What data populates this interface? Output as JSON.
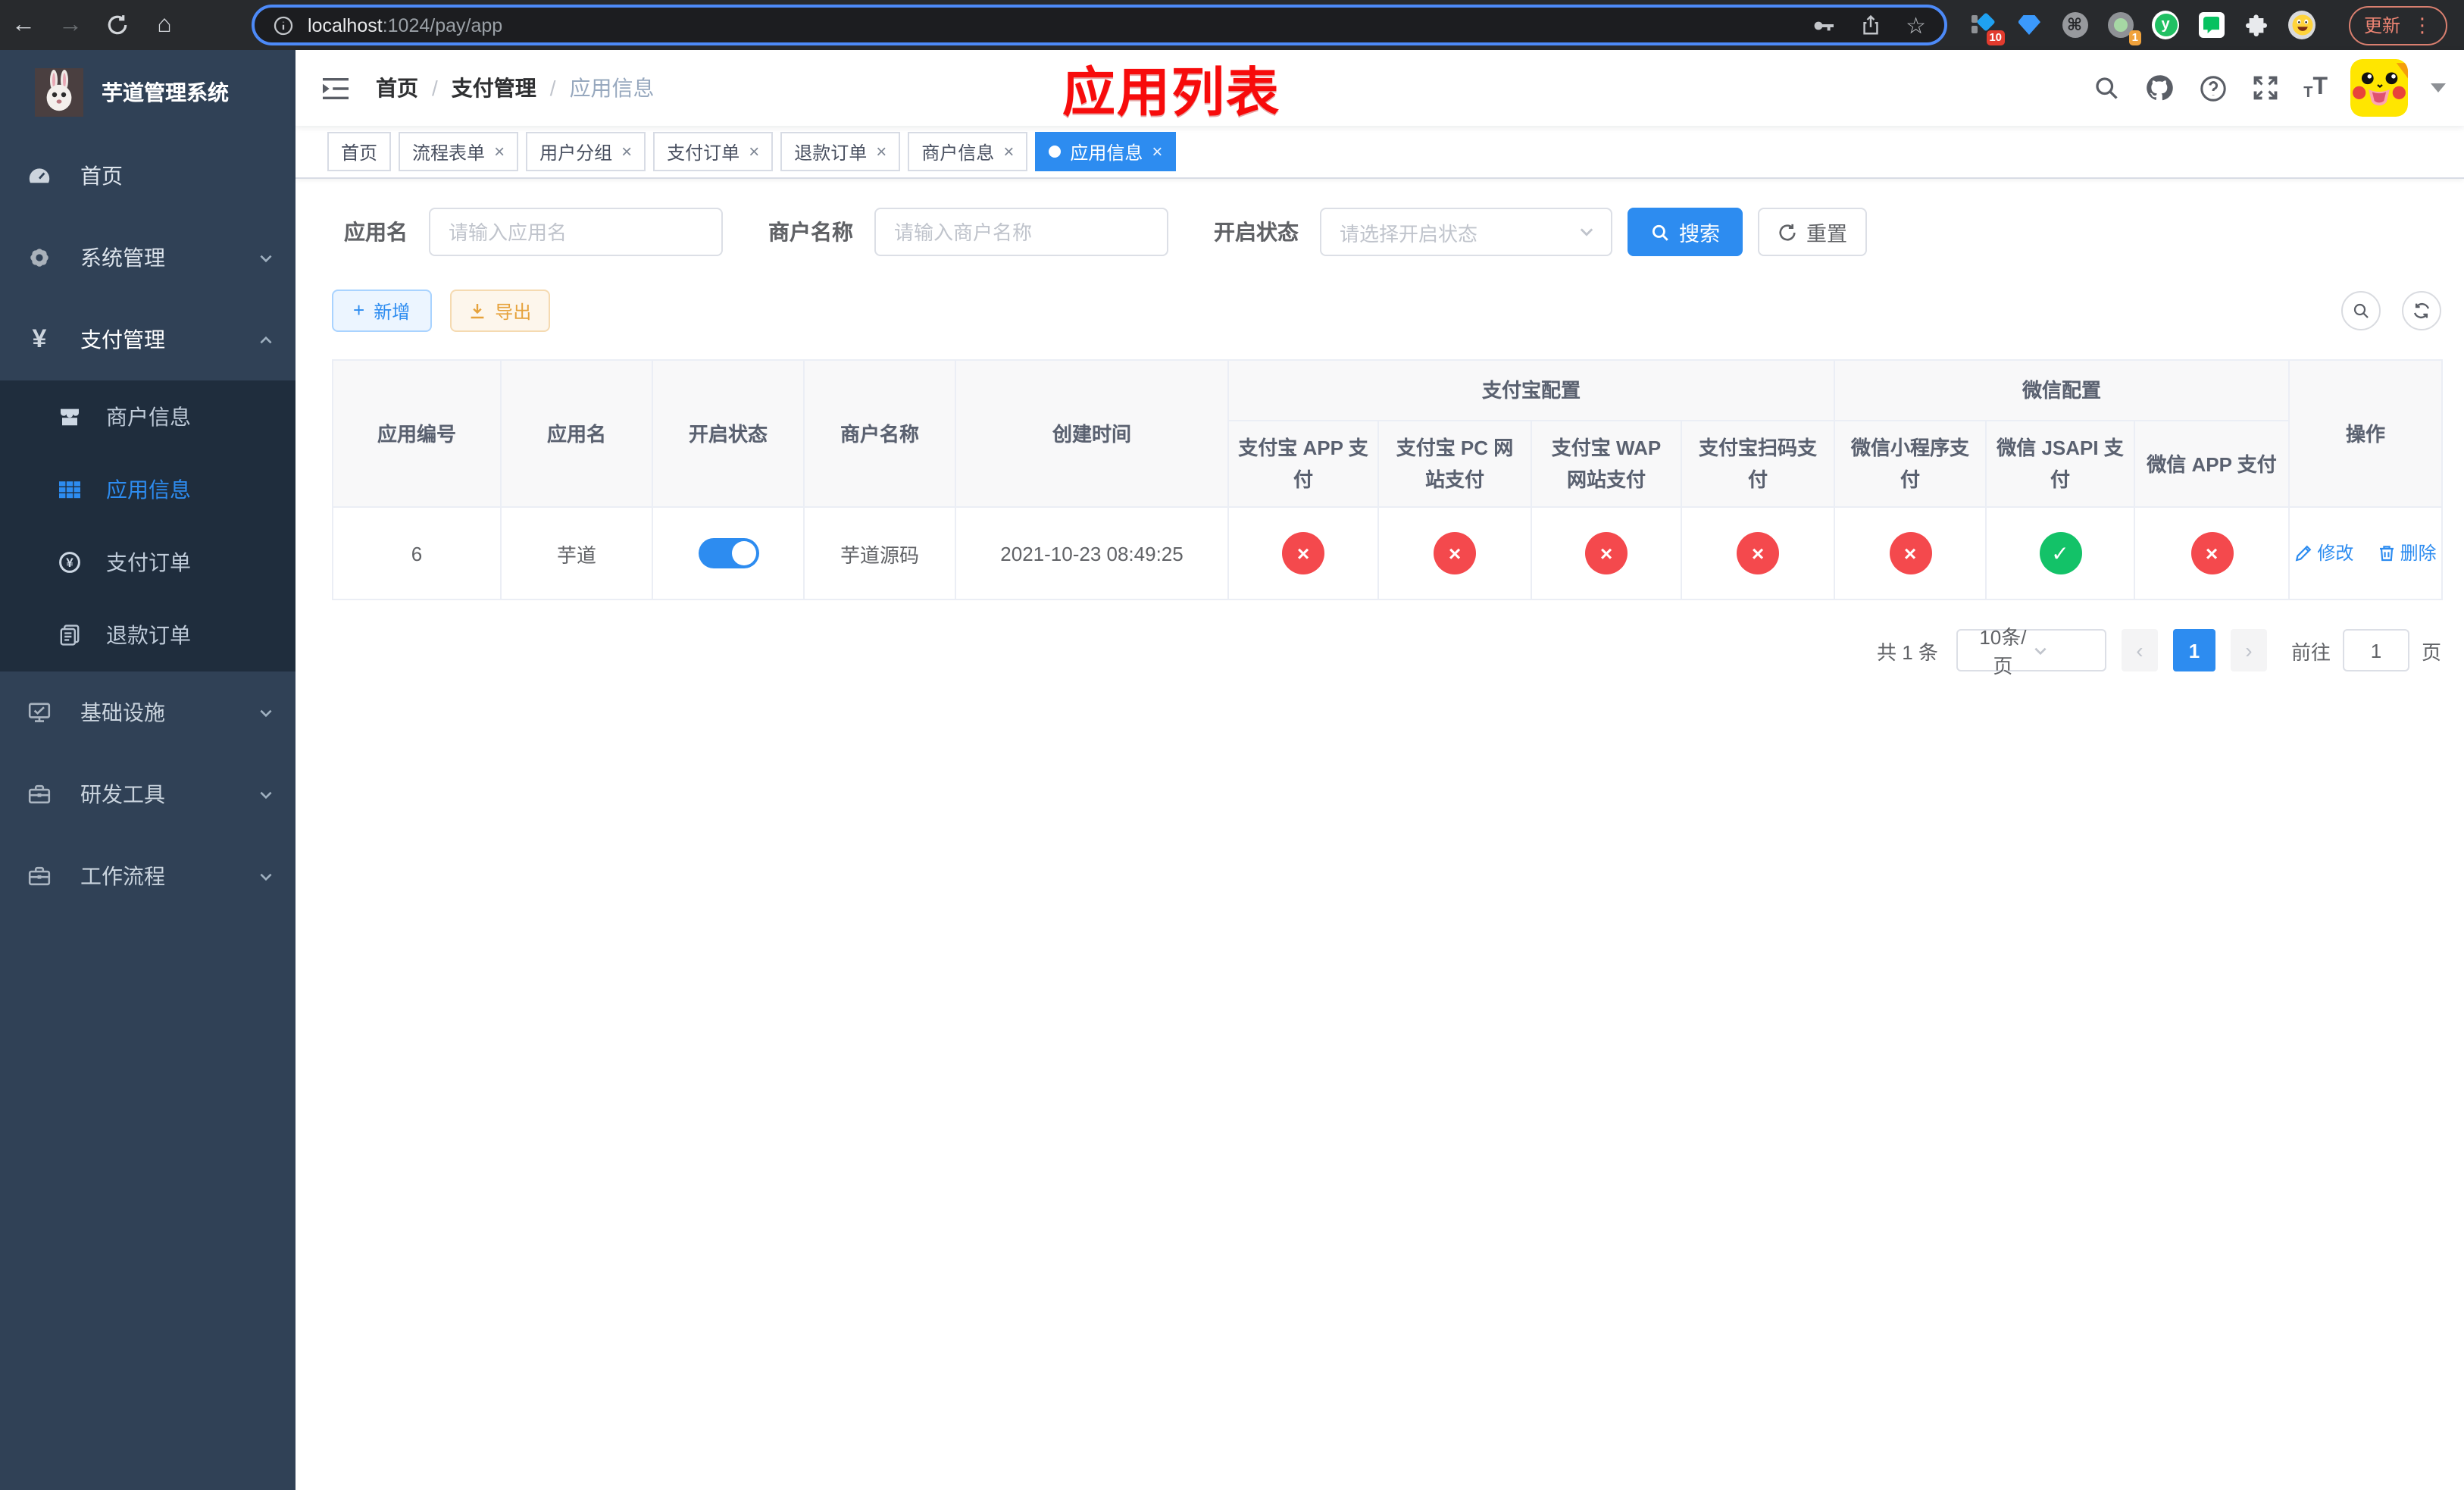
{
  "browser": {
    "url_host": "localhost",
    "url_path": ":1024/pay/app",
    "update_label": "更新",
    "ext_badge_1": "10",
    "ext_badge_2": "1",
    "menu_dots": "⋮"
  },
  "sidebar": {
    "title": "芋道管理系统",
    "items": [
      {
        "label": "首页",
        "icon": "dashboard-icon"
      },
      {
        "label": "系统管理",
        "icon": "gear-icon"
      },
      {
        "label": "支付管理",
        "icon": "yen-icon"
      },
      {
        "label": "商户信息",
        "icon": "shop-icon"
      },
      {
        "label": "应用信息",
        "icon": "grid-icon"
      },
      {
        "label": "支付订单",
        "icon": "pay-order-icon"
      },
      {
        "label": "退款订单",
        "icon": "refund-icon"
      },
      {
        "label": "基础设施",
        "icon": "monitor-icon"
      },
      {
        "label": "研发工具",
        "icon": "toolbox-icon"
      },
      {
        "label": "工作流程",
        "icon": "toolbox-icon"
      }
    ]
  },
  "header": {
    "breadcrumb": [
      "首页",
      "支付管理",
      "应用信息"
    ],
    "annotation": "应用列表"
  },
  "tabs": [
    {
      "label": "首页",
      "closable": false,
      "active": false
    },
    {
      "label": "流程表单",
      "closable": true,
      "active": false
    },
    {
      "label": "用户分组",
      "closable": true,
      "active": false
    },
    {
      "label": "支付订单",
      "closable": true,
      "active": false
    },
    {
      "label": "退款订单",
      "closable": true,
      "active": false
    },
    {
      "label": "商户信息",
      "closable": true,
      "active": false
    },
    {
      "label": "应用信息",
      "closable": true,
      "active": true
    }
  ],
  "filters": {
    "app_name_label": "应用名",
    "app_name_placeholder": "请输入应用名",
    "merchant_label": "商户名称",
    "merchant_placeholder": "请输入商户名称",
    "status_label": "开启状态",
    "status_placeholder": "请选择开启状态",
    "search_label": "搜索",
    "reset_label": "重置"
  },
  "toolbar": {
    "add_label": "新增",
    "export_label": "导出"
  },
  "table": {
    "groups": {
      "alipay": "支付宝配置",
      "wechat": "微信配置"
    },
    "columns": [
      "应用编号",
      "应用名",
      "开启状态",
      "商户名称",
      "创建时间"
    ],
    "channel_columns": [
      "支付宝 APP 支付",
      "支付宝 PC 网站支付",
      "支付宝 WAP 网站支付",
      "支付宝扫码支付",
      "微信小程序支付",
      "微信 JSAPI 支付",
      "微信 APP 支付"
    ],
    "ops_column": "操作",
    "row": {
      "id": "6",
      "name": "芋道",
      "enabled": true,
      "merchant": "芋道源码",
      "created": "2021-10-23 08:49:25",
      "channels": [
        false,
        false,
        false,
        false,
        false,
        true,
        false
      ],
      "edit_label": "修改",
      "delete_label": "删除"
    }
  },
  "pagination": {
    "total": "共 1 条",
    "page_size": "10条/页",
    "current_page": "1",
    "goto_label": "前往",
    "goto_value": "1",
    "page_unit": "页"
  },
  "colors": {
    "accent": "#2D8CF0",
    "success": "#13C268",
    "danger": "#F4494D",
    "warning": "#E6A23C",
    "sidebar_bg": "#304156",
    "submenu_bg": "#1F2D3D",
    "annotation_red": "#F70B0B"
  }
}
